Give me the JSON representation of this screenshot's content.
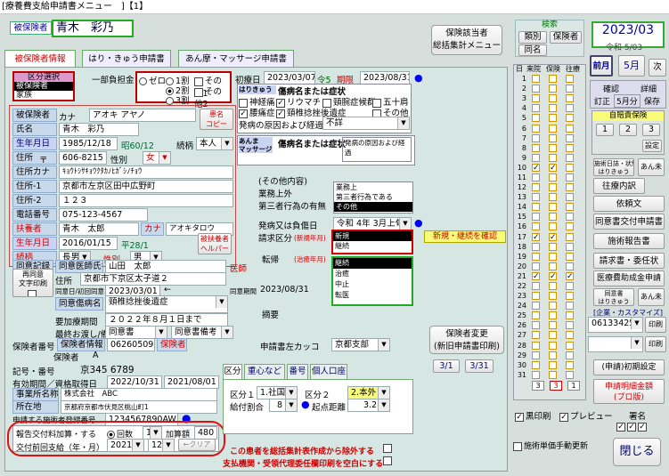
{
  "window_title": "[療養費支給申請書メニュー　]【1】",
  "header": {
    "hihokensha_label": "被保険者",
    "patient_name": "青木　彩乃",
    "btn_hokensha_line1": "保険該当者",
    "btn_hokensha_line2": "総括集計メニュー",
    "kensaku_label": "検索",
    "btn_bunrui": "類別",
    "btn_hokensha": "保険者",
    "btn_doumei": "同名",
    "year_month": "2023/03",
    "reiwa_month": "令和 5/03",
    "btn_prev_month": "前月",
    "month_label": "5月",
    "btn_next_month": "次"
  },
  "tabs": {
    "t1": "被保険者情報",
    "t2": "はり・きゅう申請書",
    "t3": "あん摩・マッサージ申請書"
  },
  "left": {
    "kubun_title": "区分選択",
    "kubun_items": [
      "被保険者",
      "家族"
    ],
    "ichibu_label": "一部負担金",
    "futan": {
      "zero": "ゼロ",
      "r1": "1割",
      "r2": "2割",
      "r3": "3割",
      "other1": "その他1",
      "other2": "その他2"
    },
    "hihokensha": "被保険者",
    "kana_label": "カナ",
    "kana_value": "アオキ アヤノ",
    "shime_label": "氏名",
    "shime_value": "青木　彩乃",
    "inkan_btn_1": "患名",
    "inkan_btn_2": "コピー",
    "birth_label": "生年月日",
    "birth_value": "1985/12/18",
    "birth_era": "昭60/12",
    "zokugara_label": "続柄",
    "zokugara_value": "本人",
    "seibetsu_label": "性別",
    "seibetsu_value": "女",
    "address_label": "住所",
    "postal_mark": "〒",
    "postal_value": "606-8215",
    "address_kana_label": "住所カナ",
    "address_kana_value": "ｷｮｳﾄｼｻｷｮｳｸﾀｶﾉﾋｶﾞｼﾉﾁｮｳ",
    "address1_label": "住所-1",
    "address1_value": "京都市左京区田中広野町",
    "address2_label": "住所-2",
    "address2_value": "１２３",
    "phone_label": "電話番号",
    "phone_value": "075-123-4567",
    "fuyou_label": "扶養者",
    "fuyou_value": "青木　太郎",
    "fuyou_kana_label": "カナ",
    "fuyou_kana_value": "アオキタロウ",
    "fuyou_birth_label": "生年月日",
    "fuyou_birth_value": "2016/01/15",
    "fuyou_era": "平28/1",
    "fuyou_btn1": "被扶養者",
    "fuyou_btn2": "ヘルパー",
    "zoku2_label": "続柄",
    "zoku2_value": "長男",
    "sei2_label": "性別",
    "sei2_value": "男",
    "doui_label": "同意記録",
    "doui_doctor_label": "同意医師氏名",
    "doui_doctor_value": "山田　太郎",
    "ishi_label": "医師",
    "shoumei_btn1": "再同意",
    "shoumei_btn2": "文字印刷",
    "doui_addr_label": "住所",
    "doui_addr_value": "京都市下京区太子道２",
    "doui_date_label": "同意日/初回同意日",
    "doui_date_value": "2023/03/01",
    "arrow": "←",
    "doui_kikan_label": "同意期間",
    "doui_kikan_value": "2023/08/31",
    "doui_byoumei_label": "同意傷病名",
    "doui_byoumei_value": "頸椎捻挫後遺症",
    "yodouki_label": "要加療期間",
    "yodouki_value": "２０２２年８月１日まで",
    "saishu_label": "最終お渡し/備考",
    "saishu_v1": "同意書",
    "saishu_v2": "同意書備考",
    "hokensha_no_label": "保険者番号",
    "hokensha_name_label": "保険者情報",
    "hokensha_no_value": "06260509",
    "hokensha_btn": "保険者",
    "hokensha_kind_label": "保険者",
    "hokensha_kind_value": "A",
    "kigou_label": "記号・番号",
    "kigou_value": "京345 6789",
    "yuukou_label": "有効期間／資格取得日",
    "yuukou_from": "2022/10/31",
    "yuukou_to": "2021/08/01",
    "jigyou_label": "事業所名称",
    "jigyou_value": "株式会社　ABC",
    "shozaichi_label": "所在地",
    "shozaichi_value": "京都府京都市伏見区桃山町1",
    "toroku_label": "申請する施術者登録番号",
    "toroku_value": "1234567890AW",
    "houkoku_label": "報告交付料加算・する",
    "kaisuu_label": "回数",
    "kaisuu_value": "1",
    "kasangaku_label": "加算額",
    "kasangaku_value": "480",
    "zenkai_label": "交付前回支給（年・月）",
    "zenkai_year": "2021",
    "zenkai_month": "12",
    "clear_btn": "←クリア"
  },
  "middle": {
    "shoken_label": "初療日",
    "shoken_value": "2023/03/07",
    "era": "令5",
    "kikan_label": "期限",
    "kikan_value": "2023/08/31",
    "hari_label": "はりきゅう",
    "shoubyou_title": "傷病名または症状",
    "conditions": [
      {
        "label": "神経痛",
        "on": false
      },
      {
        "label": "リウマチ",
        "on": true
      },
      {
        "label": "頸腕症候群",
        "on": false
      },
      {
        "label": "五十肩",
        "on": false
      },
      {
        "label": "腰痛症",
        "on": true
      },
      {
        "label": "頸椎捻挫後遺症",
        "on": true
      },
      {
        "label": "その他",
        "on": false
      }
    ],
    "genin_label": "発病の原因および経過",
    "genin_value": "不詳",
    "anma_label_1": "あんま",
    "anma_label_2": "マッサージ",
    "shoubyou2": "傷病名または症状",
    "genin2": "発病の原因および経過",
    "sonota_title": "(その他内容)",
    "gyoumujou_label": "業務上外",
    "daisansha_label": "第三者行為の有無",
    "gyoumu_options": [
      "業務上",
      "第三者行為である",
      "その他"
    ],
    "hatsubyou_label": "発病又は負傷日",
    "hatsubyou_value": "令和 4年 3月上旬頃",
    "seikyu_label": "請求区分",
    "seikyu_sub": "(新規年月)",
    "seikyu_options": [
      "新規",
      "継続"
    ],
    "seikyu_note": "新規・継続を確認",
    "tenki_label": "転帰",
    "tenki_sub": "(治癒年月)",
    "tenki_options": [
      "継続",
      "治癒",
      "中止",
      "転医"
    ],
    "tekiyou_label": "摘要",
    "hokensha_henkou_1": "保険者変更",
    "hokensha_henkou_2": "(新旧申請書印刷)",
    "shinseisho_label": "申請書左カッコ",
    "shinseisho_value": "京都支部",
    "btn_31a": "3/1",
    "btn_31b": "3/31",
    "sub_tabs": [
      "区分",
      "重心など",
      "番号",
      "個人口座"
    ],
    "kubun1_label": "区分１",
    "kubun1_value": "1.社国",
    "kubun2_label": "区分２",
    "kubun2_value": "2.本外",
    "kyufu_label": "給付割合",
    "kyufu_value": "8",
    "kiten_label": "起点距離",
    "kiten_value": "3.2",
    "warn1": "この患者を総括集計表作成から除外する",
    "warn2": "支払機関・受領代理委任欄印刷を空白にする"
  },
  "calendar": {
    "headers": [
      "日",
      "来院",
      "保険",
      "往療"
    ],
    "days": [
      1,
      2,
      3,
      4,
      5,
      6,
      7,
      8,
      9,
      10,
      11,
      12,
      13,
      14,
      15,
      16,
      17,
      18,
      19,
      20,
      21,
      22,
      23,
      24,
      25,
      26,
      27,
      28,
      29,
      30,
      31
    ],
    "raiin": [
      10,
      17,
      21
    ],
    "hoken": [
      10,
      17,
      21
    ],
    "ouryou": [
      21
    ],
    "totals": [
      "3",
      "3",
      "1"
    ]
  },
  "right": {
    "kakunin": "確認",
    "shousai": "詳細",
    "teisei": "訂正",
    "gogatsu": "5月分",
    "hozon": "保存",
    "jibaiseki": "自賠責保険",
    "n1": "1",
    "n2": "2",
    "n3": "3",
    "settei": "設定",
    "small1": "施術日誌・状態",
    "small1b": "はりきゅう",
    "anma_btn": "あん未",
    "ouryou_uchiwake": "往療内訳",
    "irai_bun": "依頼文",
    "doui_koufu": "同意書交付申請書",
    "sejutsu_houkoku": "施術報告書",
    "seikyu_inin": "請求書・委任状",
    "iryou_josei": "医療費助成金申請",
    "gyoukyo_1": "同意書",
    "gyoukyo_2": "はりきゅう",
    "anma2": "あん未",
    "kigyou_label": "[企業・カスタマイズ]",
    "kigyou_value": "06133425",
    "insatsu1": "印刷",
    "insatsu2": "印刷",
    "shoki_settei": "(申請)初期設定",
    "meisai_1": "申請明細金額",
    "meisai_2": "(プロ版)",
    "kuro_insatsu": "黒印刷",
    "preview": "プレビュー",
    "shomei": "署名",
    "tanka": "施術単価手動更新",
    "tojiru": "閉じる"
  }
}
